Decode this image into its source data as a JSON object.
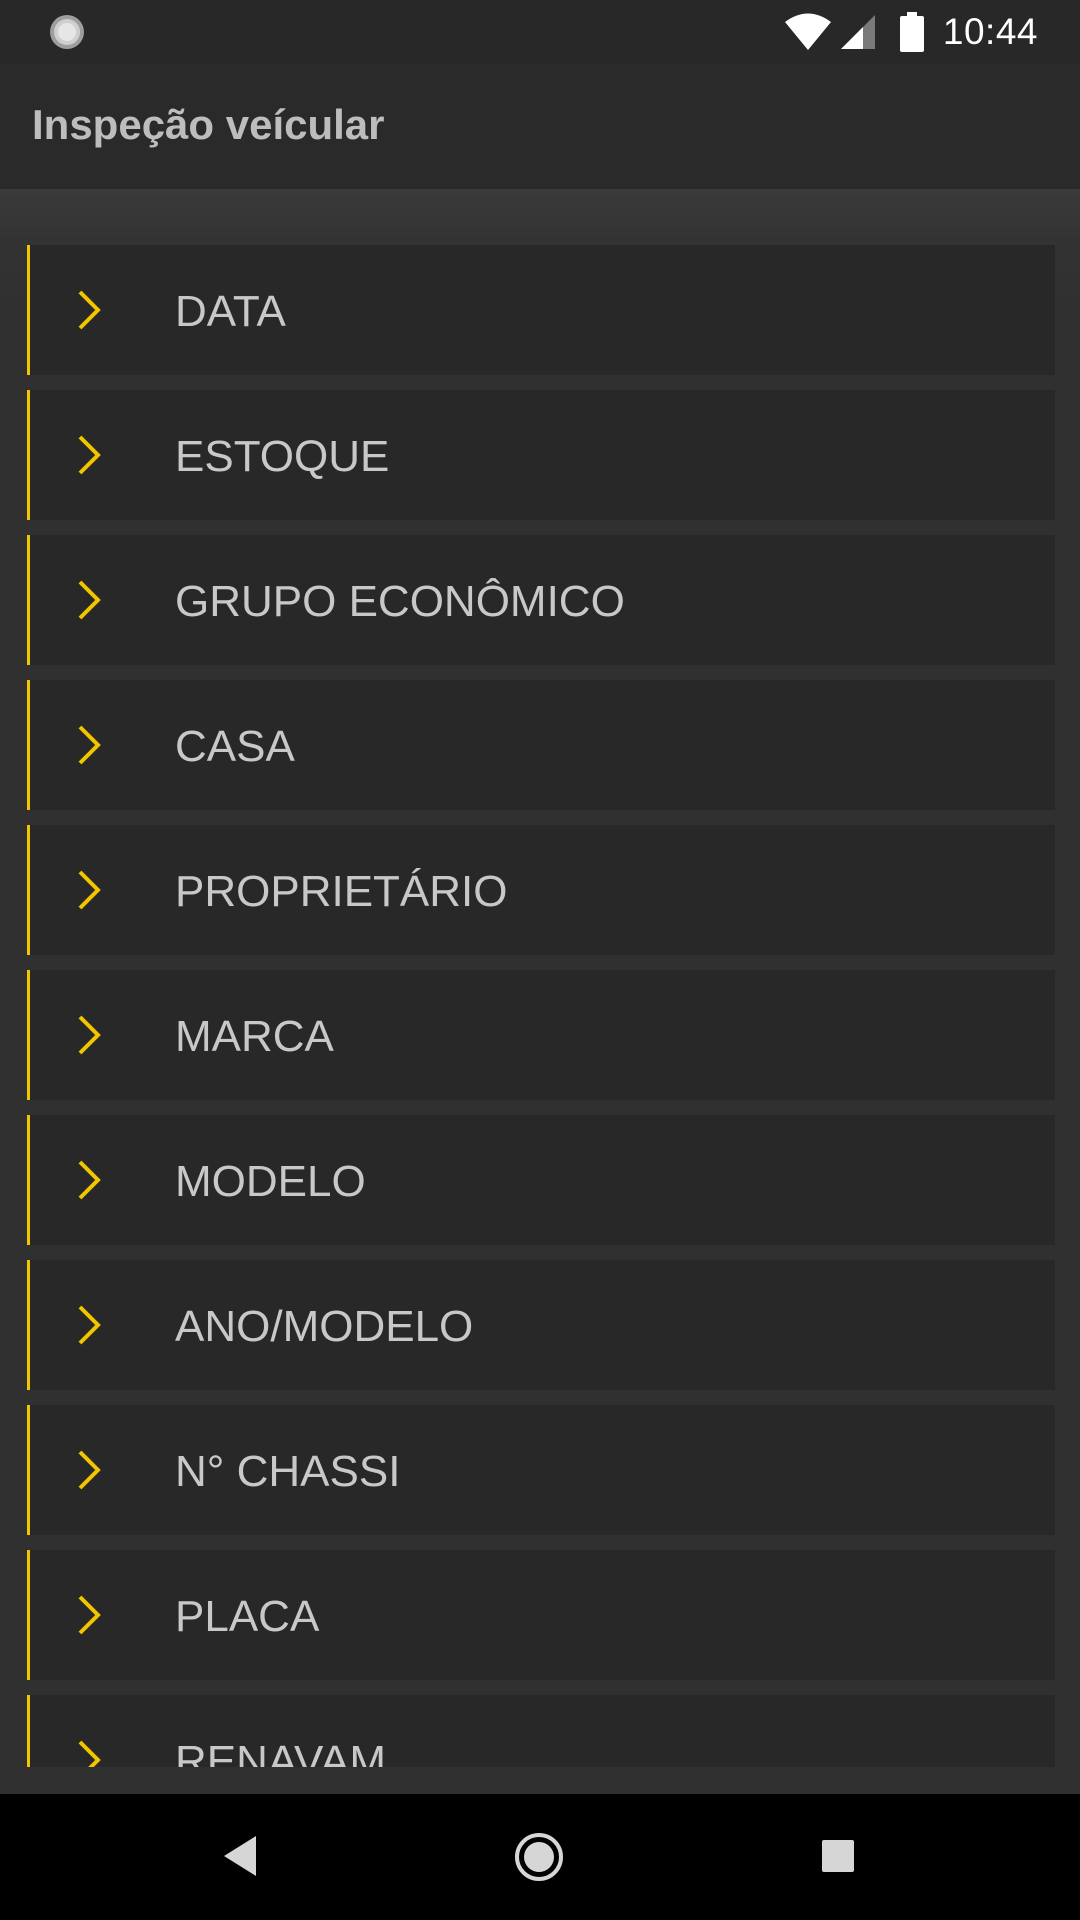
{
  "status_bar": {
    "time": "10:44",
    "icons": [
      "loading-icon",
      "wifi-icon",
      "signal-icon",
      "battery-icon"
    ]
  },
  "app_bar": {
    "title": "Inspeção veícular"
  },
  "menu": {
    "items": [
      {
        "label": "DATA"
      },
      {
        "label": "ESTOQUE"
      },
      {
        "label": "GRUPO ECONÔMICO"
      },
      {
        "label": "CASA"
      },
      {
        "label": "PROPRIETÁRIO"
      },
      {
        "label": "MARCA"
      },
      {
        "label": "MODELO"
      },
      {
        "label": "ANO/MODELO"
      },
      {
        "label": "N° CHASSI"
      },
      {
        "label": "PLACA"
      },
      {
        "label": "RENAVAM"
      }
    ]
  },
  "navigation": {
    "icons": [
      "back-icon",
      "home-icon",
      "recents-icon"
    ]
  },
  "colors": {
    "accent": "#f1c500",
    "background": "#303030",
    "item_background": "#282828",
    "text": "#c8c8c8"
  }
}
